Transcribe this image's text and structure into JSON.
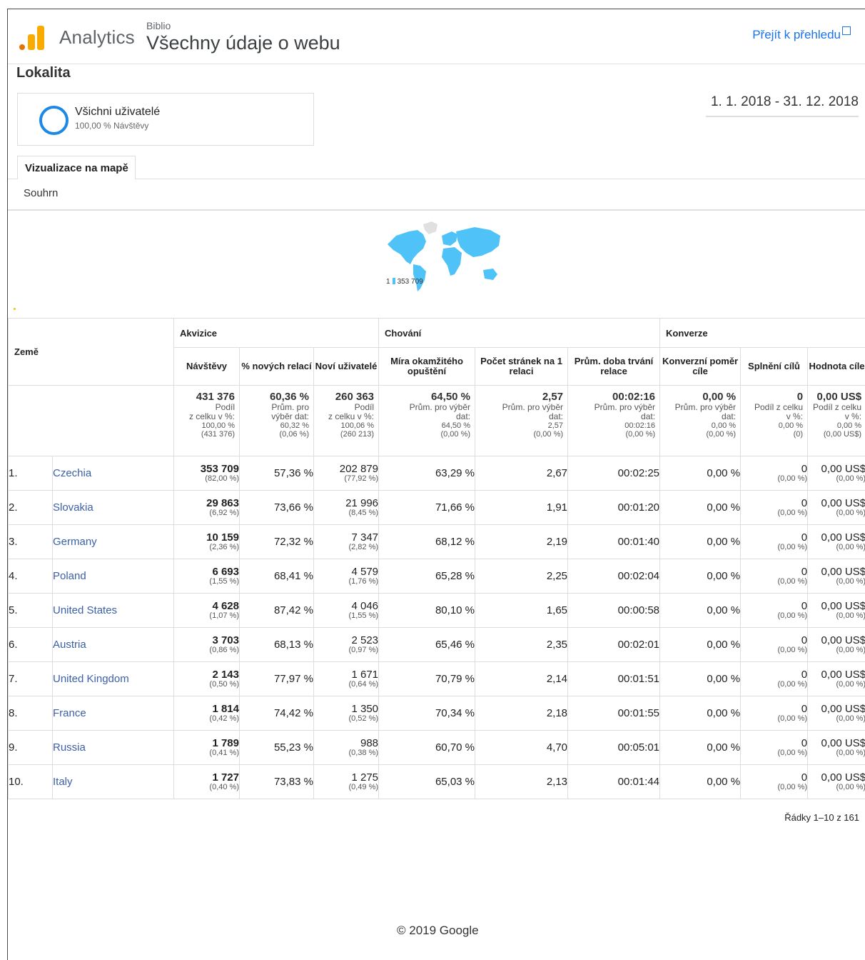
{
  "header": {
    "app_name": "Analytics",
    "account": "Biblio",
    "property": "Všechny údaje o webu",
    "goto_label": "Přejít k přehledu",
    "logo_colors": [
      "#f9ab00",
      "#e37400",
      "#e37400"
    ]
  },
  "page": {
    "title": "Lokalita",
    "date_range": "1. 1. 2018 - 31. 12. 2018"
  },
  "segment": {
    "name": "Všichni uživatelé",
    "sub": "100,00 % Návštěvy"
  },
  "tabs": {
    "map": "Vizualizace na mapě",
    "summary": "Souhrn"
  },
  "map": {
    "legend_min": "1",
    "legend_max": "353 709",
    "fill_color": "#4fc3f7"
  },
  "table": {
    "dimension": "Země",
    "groups": {
      "acquisition": "Akvizice",
      "behavior": "Chování",
      "conversion": "Konverze"
    },
    "columns": [
      "Návštěvy",
      "% nových relací",
      "Noví uživatelé",
      "Míra okamžitého opuštění",
      "Počet stránek na 1 relaci",
      "Prům. doba trvání relace",
      "Konverzní poměr cíle",
      "Splnění cílů",
      "Hodnota cíle"
    ],
    "totals": [
      {
        "value": "431 376",
        "lines": [
          "Podíl",
          "z celku v %:"
        ],
        "small": [
          "100,00 %",
          "(431 376)"
        ]
      },
      {
        "value": "60,36 %",
        "lines": [
          "Prům. pro",
          "výběr dat:"
        ],
        "small": [
          "60,32 %",
          "(0,06 %)"
        ]
      },
      {
        "value": "260 363",
        "lines": [
          "Podíl",
          "z celku v %:"
        ],
        "small": [
          "100,06 %",
          "(260 213)"
        ]
      },
      {
        "value": "64,50 %",
        "lines": [
          "Prům. pro výběr",
          "dat:"
        ],
        "small": [
          "64,50 %",
          "(0,00 %)"
        ]
      },
      {
        "value": "2,57",
        "lines": [
          "Prům. pro výběr",
          "dat:"
        ],
        "small": [
          "2,57",
          "(0,00 %)"
        ]
      },
      {
        "value": "00:02:16",
        "lines": [
          "Prům. pro výběr",
          "dat:"
        ],
        "small": [
          "00:02:16",
          "(0,00 %)"
        ]
      },
      {
        "value": "0,00 %",
        "lines": [
          "Prům. pro výběr",
          "dat:"
        ],
        "small": [
          "0,00 %",
          "(0,00 %)"
        ]
      },
      {
        "value": "0",
        "lines": [
          "Podíl z celku",
          "v %:"
        ],
        "small": [
          "0,00 %",
          "(0)"
        ]
      },
      {
        "value": "0,00 US$",
        "lines": [
          "Podíl z celku",
          "v %:"
        ],
        "small": [
          "0,00 %",
          "(0,00 US$)"
        ]
      }
    ],
    "rows": [
      {
        "rank": "1.",
        "country": "Czechia",
        "visits": "353 709",
        "visits_pct": "(82,00 %)",
        "new_pct": "57,36 %",
        "new_users": "202 879",
        "new_users_pct": "(77,92 %)",
        "bounce": "63,29 %",
        "pages": "2,67",
        "duration": "00:02:25",
        "conv": "0,00 %",
        "goals": "0",
        "goals_pct": "(0,00 %)",
        "goal_value": "0,00 US$",
        "goal_value_pct": "(0,00 %)"
      },
      {
        "rank": "2.",
        "country": "Slovakia",
        "visits": "29 863",
        "visits_pct": "(6,92 %)",
        "new_pct": "73,66 %",
        "new_users": "21 996",
        "new_users_pct": "(8,45 %)",
        "bounce": "71,66 %",
        "pages": "1,91",
        "duration": "00:01:20",
        "conv": "0,00 %",
        "goals": "0",
        "goals_pct": "(0,00 %)",
        "goal_value": "0,00 US$",
        "goal_value_pct": "(0,00 %)"
      },
      {
        "rank": "3.",
        "country": "Germany",
        "visits": "10 159",
        "visits_pct": "(2,36 %)",
        "new_pct": "72,32 %",
        "new_users": "7 347",
        "new_users_pct": "(2,82 %)",
        "bounce": "68,12 %",
        "pages": "2,19",
        "duration": "00:01:40",
        "conv": "0,00 %",
        "goals": "0",
        "goals_pct": "(0,00 %)",
        "goal_value": "0,00 US$",
        "goal_value_pct": "(0,00 %)"
      },
      {
        "rank": "4.",
        "country": "Poland",
        "visits": "6 693",
        "visits_pct": "(1,55 %)",
        "new_pct": "68,41 %",
        "new_users": "4 579",
        "new_users_pct": "(1,76 %)",
        "bounce": "65,28 %",
        "pages": "2,25",
        "duration": "00:02:04",
        "conv": "0,00 %",
        "goals": "0",
        "goals_pct": "(0,00 %)",
        "goal_value": "0,00 US$",
        "goal_value_pct": "(0,00 %)"
      },
      {
        "rank": "5.",
        "country": "United States",
        "visits": "4 628",
        "visits_pct": "(1,07 %)",
        "new_pct": "87,42 %",
        "new_users": "4 046",
        "new_users_pct": "(1,55 %)",
        "bounce": "80,10 %",
        "pages": "1,65",
        "duration": "00:00:58",
        "conv": "0,00 %",
        "goals": "0",
        "goals_pct": "(0,00 %)",
        "goal_value": "0,00 US$",
        "goal_value_pct": "(0,00 %)"
      },
      {
        "rank": "6.",
        "country": "Austria",
        "visits": "3 703",
        "visits_pct": "(0,86 %)",
        "new_pct": "68,13 %",
        "new_users": "2 523",
        "new_users_pct": "(0,97 %)",
        "bounce": "65,46 %",
        "pages": "2,35",
        "duration": "00:02:01",
        "conv": "0,00 %",
        "goals": "0",
        "goals_pct": "(0,00 %)",
        "goal_value": "0,00 US$",
        "goal_value_pct": "(0,00 %)"
      },
      {
        "rank": "7.",
        "country": "United Kingdom",
        "visits": "2 143",
        "visits_pct": "(0,50 %)",
        "new_pct": "77,97 %",
        "new_users": "1 671",
        "new_users_pct": "(0,64 %)",
        "bounce": "70,79 %",
        "pages": "2,14",
        "duration": "00:01:51",
        "conv": "0,00 %",
        "goals": "0",
        "goals_pct": "(0,00 %)",
        "goal_value": "0,00 US$",
        "goal_value_pct": "(0,00 %)"
      },
      {
        "rank": "8.",
        "country": "France",
        "visits": "1 814",
        "visits_pct": "(0,42 %)",
        "new_pct": "74,42 %",
        "new_users": "1 350",
        "new_users_pct": "(0,52 %)",
        "bounce": "70,34 %",
        "pages": "2,18",
        "duration": "00:01:55",
        "conv": "0,00 %",
        "goals": "0",
        "goals_pct": "(0,00 %)",
        "goal_value": "0,00 US$",
        "goal_value_pct": "(0,00 %)"
      },
      {
        "rank": "9.",
        "country": "Russia",
        "visits": "1 789",
        "visits_pct": "(0,41 %)",
        "new_pct": "55,23 %",
        "new_users": "988",
        "new_users_pct": "(0,38 %)",
        "bounce": "60,70 %",
        "pages": "4,70",
        "duration": "00:05:01",
        "conv": "0,00 %",
        "goals": "0",
        "goals_pct": "(0,00 %)",
        "goal_value": "0,00 US$",
        "goal_value_pct": "(0,00 %)"
      },
      {
        "rank": "10.",
        "country": "Italy",
        "visits": "1 727",
        "visits_pct": "(0,40 %)",
        "new_pct": "73,83 %",
        "new_users": "1 275",
        "new_users_pct": "(0,49 %)",
        "bounce": "65,03 %",
        "pages": "2,13",
        "duration": "00:01:44",
        "conv": "0,00 %",
        "goals": "0",
        "goals_pct": "(0,00 %)",
        "goal_value": "0,00 US$",
        "goal_value_pct": "(0,00 %)"
      }
    ],
    "rows_info": "Řádky 1–10 z 161"
  },
  "footer": "© 2019 Google"
}
